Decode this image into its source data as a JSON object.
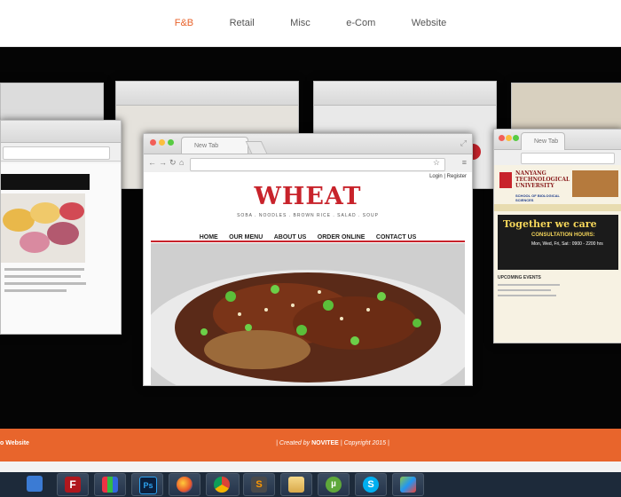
{
  "nav": {
    "items": [
      {
        "label": "F&B",
        "active": true
      },
      {
        "label": "Retail",
        "active": false
      },
      {
        "label": "Misc",
        "active": false
      },
      {
        "label": "e-Com",
        "active": false
      },
      {
        "label": "Website",
        "active": false
      }
    ],
    "accent": "#e8622a"
  },
  "showcase": {
    "main_window": {
      "tab_title": "New Tab",
      "header_links": "Login | Register",
      "site_logo": "WHEAT",
      "site_tagline": "SOBA . NOODLES . BROWN RICE . SALAD . SOUP",
      "site_menu": [
        "HOME",
        "OUR MENU",
        "ABOUT US",
        "ORDER ONLINE",
        "CONTACT US"
      ],
      "active_menu": "HOME",
      "brand_color": "#c8232b"
    },
    "right_window": {
      "tab_title": "New Tab",
      "site_name": "NANYANG TECHNOLOGICAL UNIVERSITY",
      "school": "SCHOOL OF BIOLOGICAL SCIENCES",
      "banner": "Together we care",
      "hours_title": "CONSULTATION HOURS:",
      "hours": "Mon, Wed, Fri, Sat : 0900 - 2200 hrs",
      "section": "UPCOMING EVENTS"
    }
  },
  "footer": {
    "left_text": "o Website",
    "credit_prefix": "| Created by",
    "credit_brand": "NOVITEE",
    "credit_suffix": "| Copyright 2015 |",
    "color": "#e8652c"
  },
  "taskbar": {
    "apps": [
      "network-icon",
      "filezilla-icon",
      "apps-grid-icon",
      "photoshop-icon",
      "firefox-icon",
      "chrome-icon",
      "sublime-icon",
      "explorer-icon",
      "utorrent-icon",
      "skype-icon",
      "bluestacks-icon"
    ]
  }
}
